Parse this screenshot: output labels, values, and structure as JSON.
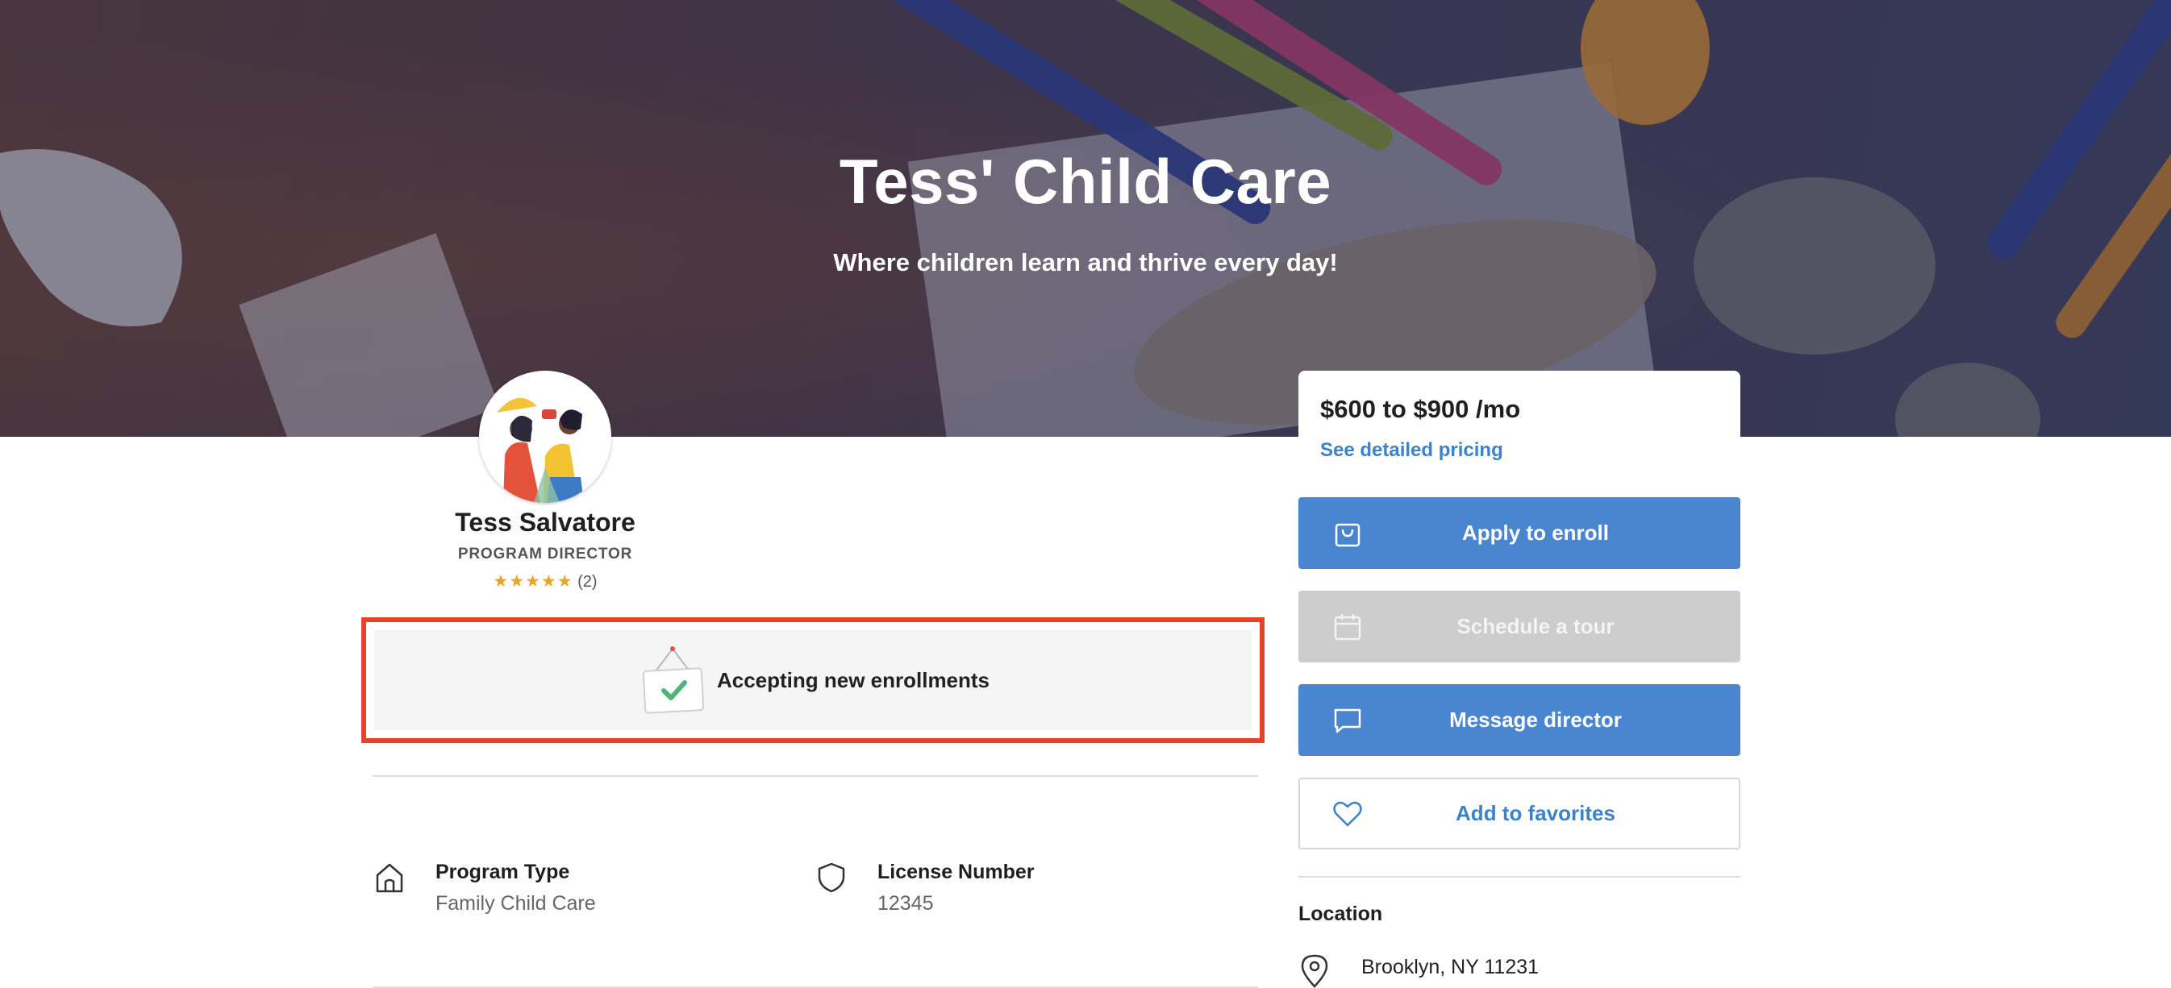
{
  "hero": {
    "title": "Tess' Child Care",
    "subtitle": "Where children learn and thrive every day!"
  },
  "director": {
    "name": "Tess Salvatore",
    "role": "PROGRAM DIRECTOR",
    "stars": "★★★★★",
    "review_count": "(2)",
    "rating": 5
  },
  "enrollment": {
    "status": "Accepting new enrollments"
  },
  "info": {
    "program_type_label": "Program Type",
    "program_type_value": "Family Child Care",
    "license_label": "License Number",
    "license_value": "12345"
  },
  "pricing": {
    "range": "$600 to $900 /mo",
    "link": "See detailed pricing"
  },
  "actions": {
    "apply": "Apply to enroll",
    "tour": "Schedule a tour",
    "message": "Message director",
    "favorite": "Add to favorites"
  },
  "location": {
    "title": "Location",
    "address": "Brooklyn, NY 11231"
  },
  "colors": {
    "primary_blue": "#4a86cf",
    "link_blue": "#3a82cc",
    "disabled_grey": "#cdcdcd",
    "highlight_red": "#e4422d",
    "star_gold": "#e7a528"
  },
  "icons": {
    "apply": "shopping-bag-icon",
    "tour": "calendar-icon",
    "message": "chat-bubble-icon",
    "favorite": "heart-icon",
    "program_type": "home-icon",
    "license": "shield-icon",
    "location": "map-pin-icon",
    "enrollment": "hanging-sign-check-icon"
  }
}
